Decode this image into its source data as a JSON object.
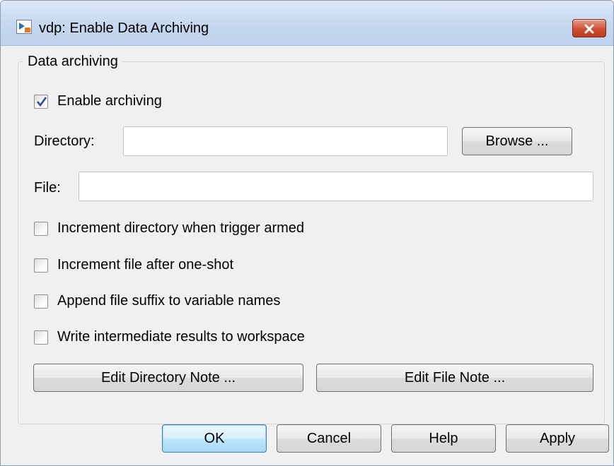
{
  "window": {
    "title": "vdp: Enable Data Archiving"
  },
  "group": {
    "legend": "Data archiving"
  },
  "archiving": {
    "enable_label": "Enable archiving",
    "enable_checked": true
  },
  "directory": {
    "label": "Directory:",
    "value": "",
    "browse_label": "Browse ..."
  },
  "file": {
    "label": "File:",
    "value": ""
  },
  "options": [
    {
      "label": "Increment directory when trigger armed",
      "checked": false
    },
    {
      "label": "Increment file after one-shot",
      "checked": false
    },
    {
      "label": "Append file suffix to variable names",
      "checked": false
    },
    {
      "label": "Write intermediate results to workspace",
      "checked": false
    }
  ],
  "notes": {
    "edit_directory_note": "Edit Directory Note ...",
    "edit_file_note": "Edit File Note ..."
  },
  "footer": {
    "ok": "OK",
    "cancel": "Cancel",
    "help": "Help",
    "apply": "Apply"
  },
  "colors": {
    "title_bar": "#c4d7ef",
    "close_button": "#cf4f35",
    "default_button_border": "#3c7fb1"
  }
}
